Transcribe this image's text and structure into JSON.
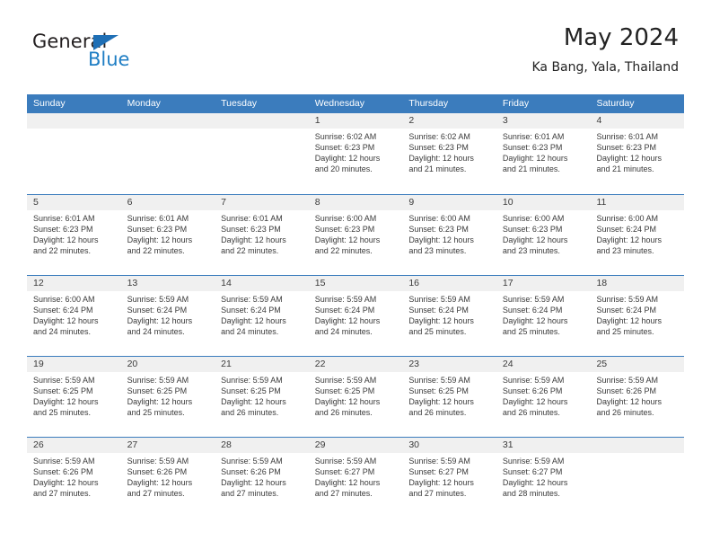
{
  "brand": {
    "name_part1": "General",
    "name_part2": "Blue",
    "triangle_color": "#1f6fb5",
    "blue_color": "#1f7ec4"
  },
  "header": {
    "title": "May 2024",
    "location": "Ka Bang, Yala, Thailand"
  },
  "theme": {
    "header_blue": "#3b7cbd",
    "day_band_gray": "#f0f0f0",
    "text_color": "#3a3a3a"
  },
  "weekdays": [
    "Sunday",
    "Monday",
    "Tuesday",
    "Wednesday",
    "Thursday",
    "Friday",
    "Saturday"
  ],
  "weeks": [
    [
      {
        "empty": true
      },
      {
        "empty": true
      },
      {
        "empty": true
      },
      {
        "day": "1",
        "sunrise": "Sunrise: 6:02 AM",
        "sunset": "Sunset: 6:23 PM",
        "daylight1": "Daylight: 12 hours",
        "daylight2": "and 20 minutes."
      },
      {
        "day": "2",
        "sunrise": "Sunrise: 6:02 AM",
        "sunset": "Sunset: 6:23 PM",
        "daylight1": "Daylight: 12 hours",
        "daylight2": "and 21 minutes."
      },
      {
        "day": "3",
        "sunrise": "Sunrise: 6:01 AM",
        "sunset": "Sunset: 6:23 PM",
        "daylight1": "Daylight: 12 hours",
        "daylight2": "and 21 minutes."
      },
      {
        "day": "4",
        "sunrise": "Sunrise: 6:01 AM",
        "sunset": "Sunset: 6:23 PM",
        "daylight1": "Daylight: 12 hours",
        "daylight2": "and 21 minutes."
      }
    ],
    [
      {
        "day": "5",
        "sunrise": "Sunrise: 6:01 AM",
        "sunset": "Sunset: 6:23 PM",
        "daylight1": "Daylight: 12 hours",
        "daylight2": "and 22 minutes."
      },
      {
        "day": "6",
        "sunrise": "Sunrise: 6:01 AM",
        "sunset": "Sunset: 6:23 PM",
        "daylight1": "Daylight: 12 hours",
        "daylight2": "and 22 minutes."
      },
      {
        "day": "7",
        "sunrise": "Sunrise: 6:01 AM",
        "sunset": "Sunset: 6:23 PM",
        "daylight1": "Daylight: 12 hours",
        "daylight2": "and 22 minutes."
      },
      {
        "day": "8",
        "sunrise": "Sunrise: 6:00 AM",
        "sunset": "Sunset: 6:23 PM",
        "daylight1": "Daylight: 12 hours",
        "daylight2": "and 22 minutes."
      },
      {
        "day": "9",
        "sunrise": "Sunrise: 6:00 AM",
        "sunset": "Sunset: 6:23 PM",
        "daylight1": "Daylight: 12 hours",
        "daylight2": "and 23 minutes."
      },
      {
        "day": "10",
        "sunrise": "Sunrise: 6:00 AM",
        "sunset": "Sunset: 6:23 PM",
        "daylight1": "Daylight: 12 hours",
        "daylight2": "and 23 minutes."
      },
      {
        "day": "11",
        "sunrise": "Sunrise: 6:00 AM",
        "sunset": "Sunset: 6:24 PM",
        "daylight1": "Daylight: 12 hours",
        "daylight2": "and 23 minutes."
      }
    ],
    [
      {
        "day": "12",
        "sunrise": "Sunrise: 6:00 AM",
        "sunset": "Sunset: 6:24 PM",
        "daylight1": "Daylight: 12 hours",
        "daylight2": "and 24 minutes."
      },
      {
        "day": "13",
        "sunrise": "Sunrise: 5:59 AM",
        "sunset": "Sunset: 6:24 PM",
        "daylight1": "Daylight: 12 hours",
        "daylight2": "and 24 minutes."
      },
      {
        "day": "14",
        "sunrise": "Sunrise: 5:59 AM",
        "sunset": "Sunset: 6:24 PM",
        "daylight1": "Daylight: 12 hours",
        "daylight2": "and 24 minutes."
      },
      {
        "day": "15",
        "sunrise": "Sunrise: 5:59 AM",
        "sunset": "Sunset: 6:24 PM",
        "daylight1": "Daylight: 12 hours",
        "daylight2": "and 24 minutes."
      },
      {
        "day": "16",
        "sunrise": "Sunrise: 5:59 AM",
        "sunset": "Sunset: 6:24 PM",
        "daylight1": "Daylight: 12 hours",
        "daylight2": "and 25 minutes."
      },
      {
        "day": "17",
        "sunrise": "Sunrise: 5:59 AM",
        "sunset": "Sunset: 6:24 PM",
        "daylight1": "Daylight: 12 hours",
        "daylight2": "and 25 minutes."
      },
      {
        "day": "18",
        "sunrise": "Sunrise: 5:59 AM",
        "sunset": "Sunset: 6:24 PM",
        "daylight1": "Daylight: 12 hours",
        "daylight2": "and 25 minutes."
      }
    ],
    [
      {
        "day": "19",
        "sunrise": "Sunrise: 5:59 AM",
        "sunset": "Sunset: 6:25 PM",
        "daylight1": "Daylight: 12 hours",
        "daylight2": "and 25 minutes."
      },
      {
        "day": "20",
        "sunrise": "Sunrise: 5:59 AM",
        "sunset": "Sunset: 6:25 PM",
        "daylight1": "Daylight: 12 hours",
        "daylight2": "and 25 minutes."
      },
      {
        "day": "21",
        "sunrise": "Sunrise: 5:59 AM",
        "sunset": "Sunset: 6:25 PM",
        "daylight1": "Daylight: 12 hours",
        "daylight2": "and 26 minutes."
      },
      {
        "day": "22",
        "sunrise": "Sunrise: 5:59 AM",
        "sunset": "Sunset: 6:25 PM",
        "daylight1": "Daylight: 12 hours",
        "daylight2": "and 26 minutes."
      },
      {
        "day": "23",
        "sunrise": "Sunrise: 5:59 AM",
        "sunset": "Sunset: 6:25 PM",
        "daylight1": "Daylight: 12 hours",
        "daylight2": "and 26 minutes."
      },
      {
        "day": "24",
        "sunrise": "Sunrise: 5:59 AM",
        "sunset": "Sunset: 6:26 PM",
        "daylight1": "Daylight: 12 hours",
        "daylight2": "and 26 minutes."
      },
      {
        "day": "25",
        "sunrise": "Sunrise: 5:59 AM",
        "sunset": "Sunset: 6:26 PM",
        "daylight1": "Daylight: 12 hours",
        "daylight2": "and 26 minutes."
      }
    ],
    [
      {
        "day": "26",
        "sunrise": "Sunrise: 5:59 AM",
        "sunset": "Sunset: 6:26 PM",
        "daylight1": "Daylight: 12 hours",
        "daylight2": "and 27 minutes."
      },
      {
        "day": "27",
        "sunrise": "Sunrise: 5:59 AM",
        "sunset": "Sunset: 6:26 PM",
        "daylight1": "Daylight: 12 hours",
        "daylight2": "and 27 minutes."
      },
      {
        "day": "28",
        "sunrise": "Sunrise: 5:59 AM",
        "sunset": "Sunset: 6:26 PM",
        "daylight1": "Daylight: 12 hours",
        "daylight2": "and 27 minutes."
      },
      {
        "day": "29",
        "sunrise": "Sunrise: 5:59 AM",
        "sunset": "Sunset: 6:27 PM",
        "daylight1": "Daylight: 12 hours",
        "daylight2": "and 27 minutes."
      },
      {
        "day": "30",
        "sunrise": "Sunrise: 5:59 AM",
        "sunset": "Sunset: 6:27 PM",
        "daylight1": "Daylight: 12 hours",
        "daylight2": "and 27 minutes."
      },
      {
        "day": "31",
        "sunrise": "Sunrise: 5:59 AM",
        "sunset": "Sunset: 6:27 PM",
        "daylight1": "Daylight: 12 hours",
        "daylight2": "and 28 minutes."
      },
      {
        "empty": true
      }
    ]
  ]
}
